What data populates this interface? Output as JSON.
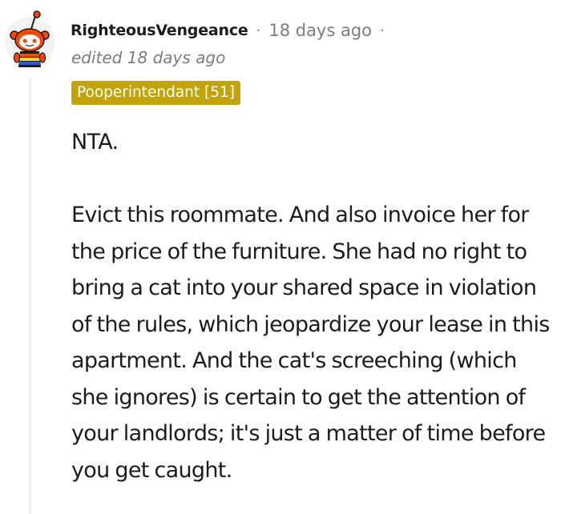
{
  "comment": {
    "username": "RighteousVengeance",
    "separator": "·",
    "timestamp": "18 days ago",
    "timestamp_separator": "·",
    "edited": "edited 18 days ago",
    "flair": "Pooperintendant [51]",
    "paragraphs": [
      "NTA.",
      "Evict this roommate. And also invoice her for the price of the furniture. She had no right to bring a cat into your shared space in violation of the rules, which jeopardize your lease in this apartment. And the cat's screeching (which she ignores) is certain to get the attention of your landlords; it's just a matter of time before you get caught."
    ]
  },
  "avatar": {
    "icon": "snoo-avatar-icon",
    "colors": {
      "head": "#ff4500",
      "shirt_stripes": [
        "#ff4500",
        "#ffd635",
        "#2a5ad6"
      ],
      "flair_bg": "#c2a308"
    }
  }
}
